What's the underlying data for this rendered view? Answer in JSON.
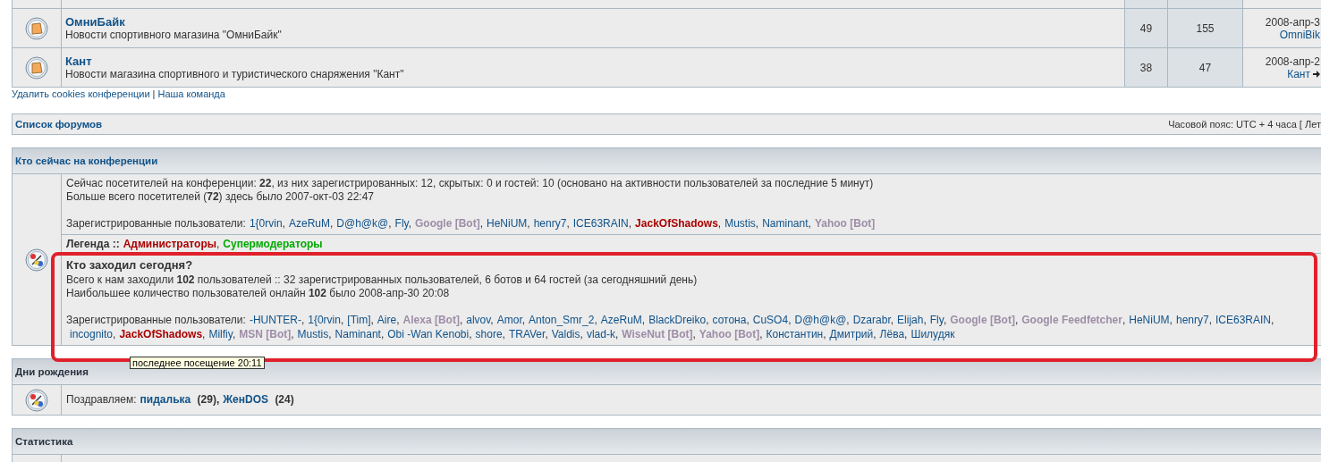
{
  "forums": [
    {
      "name": "ОмниБайк",
      "description": "Новости спортивного магазина \"ОмниБайк\"",
      "topics": "49",
      "posts": "155",
      "last_post_date": "2008-апр-3",
      "last_post_author": "OmniBik"
    },
    {
      "name": "Кант",
      "description": "Новости магазина спортивного и туристического снаряжения \"Кант\"",
      "topics": "38",
      "posts": "47",
      "last_post_date": "2008-апр-2",
      "last_post_author": "Кант"
    }
  ],
  "footer_links": [
    "Удалить cookies конференции",
    "Наша команда"
  ],
  "footer_separator": "|",
  "nav": {
    "forum_list": "Список форумов",
    "timezone": "Часовой пояс: UTC + 4 часа [ Лет"
  },
  "users_separator": ",",
  "online": {
    "title": "Кто сейчас на конференции",
    "summary": "Сейчас посетителей на конференции: **22**, из них зарегистрированных: 12, скрытых: 0 и гостей: 10 (основано на активности пользователей за последние 5 минут)",
    "record": "Больше всего посетителей (**72**) здесь было 2007-окт-03 22:47",
    "users_label": "Зарегистрированные пользователи:",
    "users": [
      {
        "name": "1{0rvin",
        "kind": "user"
      },
      {
        "name": "AzeRuM",
        "kind": "user"
      },
      {
        "name": "D@h@k@",
        "kind": "user"
      },
      {
        "name": "Fly",
        "kind": "user"
      },
      {
        "name": "Google [Bot]",
        "kind": "bot"
      },
      {
        "name": "HeNiUM",
        "kind": "user"
      },
      {
        "name": "henry7",
        "kind": "user"
      },
      {
        "name": "ICE63RAIN",
        "kind": "user"
      },
      {
        "name": "JackOfShadows",
        "kind": "admin"
      },
      {
        "name": "Mustis",
        "kind": "user"
      },
      {
        "name": "Naminant",
        "kind": "user"
      },
      {
        "name": "Yahoo [Bot]",
        "kind": "bot"
      }
    ],
    "legend_label": "Легенда ::",
    "legend": [
      {
        "name": "Администраторы",
        "color": "#aa0000"
      },
      {
        "name": "Супермодераторы",
        "color": "#00aa00"
      }
    ]
  },
  "today": {
    "title": "Кто заходил сегодня?",
    "summary": "Всего к нам заходили **102** пользователей :: 32 зарегистрированных пользователей, 6 ботов и 64 гостей (за сегодняшний день)",
    "record": "Наибольшее количество пользователей онлайн **102** было 2008-апр-30 20:08",
    "users_label": "Зарегистрированные пользователи:",
    "users": [
      {
        "name": "-HUNTER-",
        "kind": "user"
      },
      {
        "name": "1{0rvin",
        "kind": "user"
      },
      {
        "name": "[Tim]",
        "kind": "user"
      },
      {
        "name": "Aire",
        "kind": "user"
      },
      {
        "name": "Alexa [Bot]",
        "kind": "bot"
      },
      {
        "name": "alvov",
        "kind": "user"
      },
      {
        "name": "Amor",
        "kind": "user"
      },
      {
        "name": "Anton_Smr_2",
        "kind": "user"
      },
      {
        "name": "AzeRuM",
        "kind": "user"
      },
      {
        "name": "BlackDreiko",
        "kind": "user"
      },
      {
        "name": "сотона",
        "kind": "user"
      },
      {
        "name": "CuSO4",
        "kind": "user"
      },
      {
        "name": "D@h@k@",
        "kind": "user"
      },
      {
        "name": "Dzarabr",
        "kind": "user"
      },
      {
        "name": "Elijah",
        "kind": "user"
      },
      {
        "name": "Fly",
        "kind": "user"
      },
      {
        "name": "Google [Bot]",
        "kind": "bot"
      },
      {
        "name": "Google Feedfetcher",
        "kind": "bot"
      },
      {
        "name": "HeNiUM",
        "kind": "user"
      },
      {
        "name": "henry7",
        "kind": "user"
      },
      {
        "name": "ICE63RAIN",
        "kind": "user"
      },
      {
        "name": "incognito",
        "kind": "user"
      },
      {
        "name": "JackOfShadows",
        "kind": "admin"
      },
      {
        "name": "Milfiy",
        "kind": "user"
      },
      {
        "name": "MSN [Bot]",
        "kind": "bot"
      },
      {
        "name": "Mustis",
        "kind": "user"
      },
      {
        "name": "Naminant",
        "kind": "user"
      },
      {
        "name": "Obi -Wan Kenobi",
        "kind": "user"
      },
      {
        "name": "shore",
        "kind": "user"
      },
      {
        "name": "TRAVer",
        "kind": "user"
      },
      {
        "name": "Valdis",
        "kind": "user"
      },
      {
        "name": "vlad-k",
        "kind": "user"
      },
      {
        "name": "WiseNut [Bot]",
        "kind": "bot"
      },
      {
        "name": "Yahoo [Bot]",
        "kind": "bot"
      },
      {
        "name": "Константин",
        "kind": "user"
      },
      {
        "name": "Дмитрий",
        "kind": "user"
      },
      {
        "name": "Лёва",
        "kind": "user"
      },
      {
        "name": "Шилудяк",
        "kind": "user"
      }
    ]
  },
  "tooltip": "последнее посещение 20:11",
  "birthdays": {
    "title": "Дни рождения",
    "label": "Поздравляем:",
    "people": [
      {
        "name": "пидалька",
        "age": "(29)"
      },
      {
        "name": "ЖенDOS",
        "age": "(24)"
      }
    ]
  },
  "statistics": {
    "title": "Статистика"
  }
}
